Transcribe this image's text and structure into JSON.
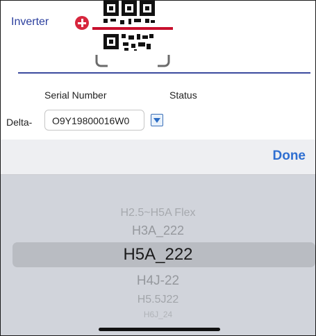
{
  "form": {
    "inverter_label": "Inverter",
    "serial_header": "Serial Number",
    "status_header": "Status",
    "prefix": "Delta-",
    "serial_value": "O9Y19800016W0"
  },
  "picker": {
    "done_label": "Done",
    "options": [
      "H2.5~H5A Flex",
      "H3A_222",
      "H5A_222",
      "H4J-22",
      "H5.5J22",
      "H6J_24"
    ],
    "selected": "H5A_222"
  },
  "colors": {
    "accent_blue": "#2b3f9e",
    "done_blue": "#2f6fd1",
    "add_red": "#d7263d",
    "scanner_red": "#c8102e"
  }
}
